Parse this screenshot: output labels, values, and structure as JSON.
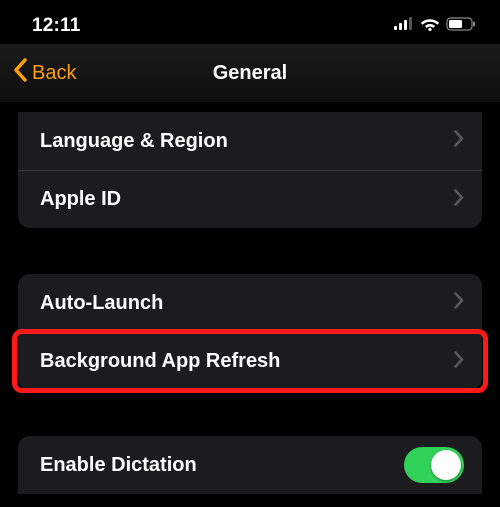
{
  "status": {
    "time": "12:11"
  },
  "nav": {
    "back": "Back",
    "title": "General"
  },
  "group1": [
    {
      "label": "Language & Region"
    },
    {
      "label": "Apple ID"
    }
  ],
  "group2": [
    {
      "label": "Auto-Launch"
    },
    {
      "label": "Background App Refresh"
    }
  ],
  "group3": [
    {
      "label": "Enable Dictation",
      "toggle": true
    }
  ]
}
